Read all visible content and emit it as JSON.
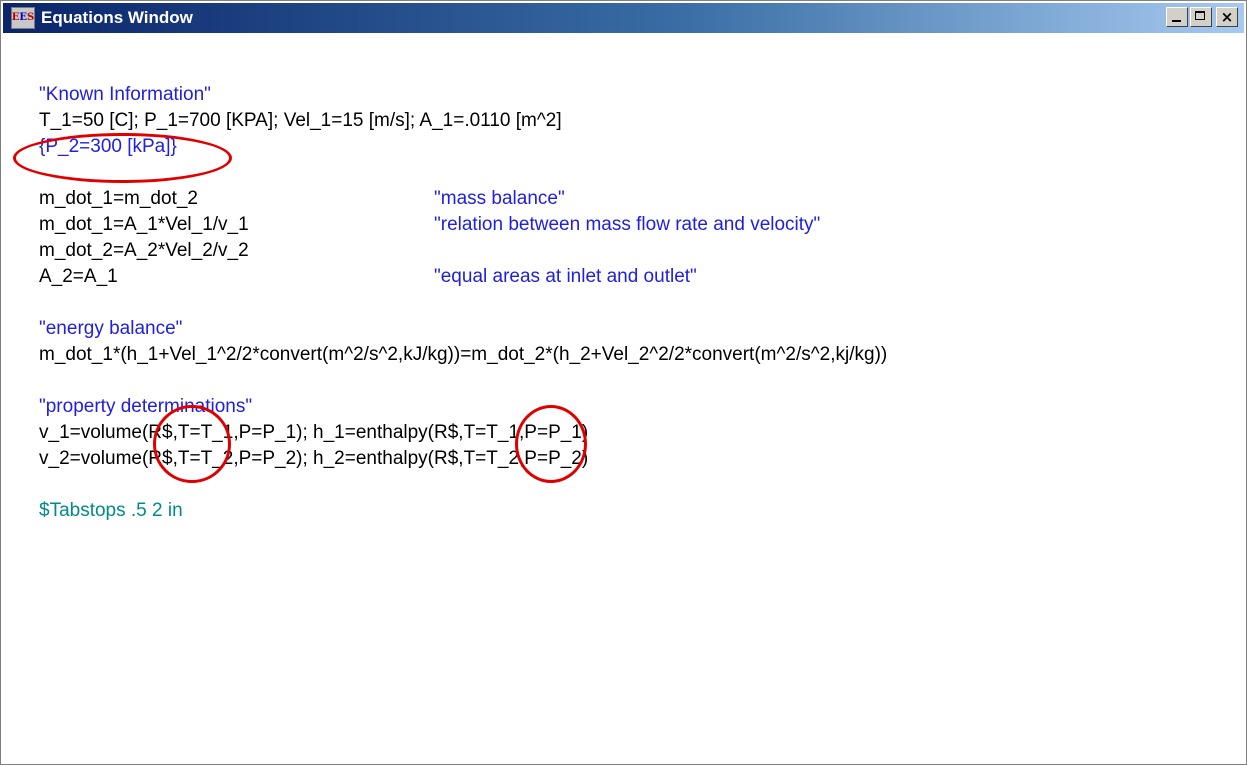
{
  "window": {
    "title": "Equations Window",
    "icon": "ees-app-icon",
    "icon_letters": [
      "E",
      "E",
      "S"
    ],
    "buttons": {
      "minimize": "minimize-icon",
      "maximize": "maximize-icon",
      "close": "✕"
    },
    "close_glyph": "×"
  },
  "colors": {
    "equation_text": "#000000",
    "comment_text": "#2020e0",
    "directive_text": "#008b8b",
    "annotation": "#e00000",
    "titlebar_start": "#0a246a",
    "titlebar_end": "#a6caf0"
  },
  "equations": {
    "known_comment": "\"Known Information\"",
    "known_line": "T_1=50 [C]; P_1=700 [KPA]; Vel_1=15 [m/s]; A_1=.0110 [m^2]",
    "p2_comment_line": "{P_2=300 [kPa]}",
    "mass_lines": [
      {
        "eq": "m_dot_1=m_dot_2",
        "comment": "\"mass balance\""
      },
      {
        "eq": "m_dot_1=A_1*Vel_1/v_1",
        "comment": "\"relation between mass flow rate and velocity\""
      },
      {
        "eq": "m_dot_2=A_2*Vel_2/v_2",
        "comment": ""
      },
      {
        "eq": "A_2=A_1",
        "comment": "\"equal areas at inlet and outlet\""
      }
    ],
    "energy_comment": "\"energy balance\"",
    "energy_line": "m_dot_1*(h_1+Vel_1^2/2*convert(m^2/s^2,kJ/kg))=m_dot_2*(h_2+Vel_2^2/2*convert(m^2/s^2,kj/kg))",
    "property_comment": "\"property determinations\"",
    "property_lines": [
      "v_1=volume(R$,T=T_1,P=P_1); h_1=enthalpy(R$,T=T_1,P=P_1)",
      "v_2=volume(R$,T=T_2,P=P_2); h_2=enthalpy(R$,T=T_2,P=P_2)"
    ],
    "tabstops_directive": "$Tabstops .5 2 in"
  }
}
